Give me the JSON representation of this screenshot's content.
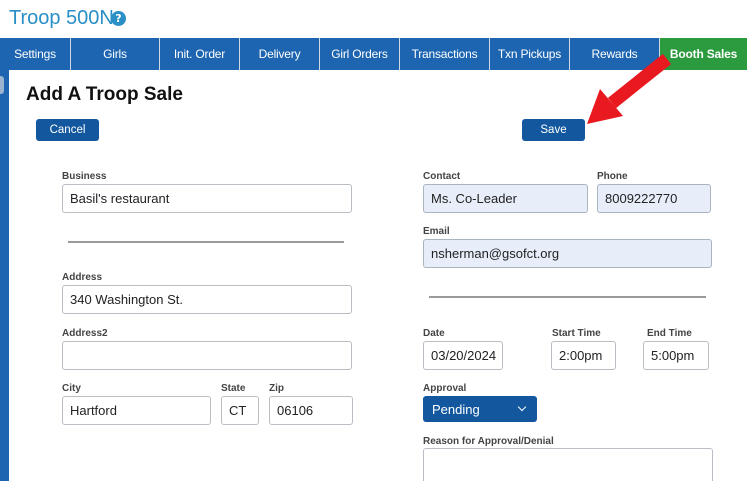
{
  "header": {
    "troop_title": "Troop 500N",
    "help_icon": "help-circle-icon",
    "help_glyph": "?"
  },
  "tabs": [
    {
      "label": "Settings",
      "active": false
    },
    {
      "label": "Girls",
      "active": false
    },
    {
      "label": "Init. Order",
      "active": false
    },
    {
      "label": "Delivery",
      "active": false
    },
    {
      "label": "Girl Orders",
      "active": false
    },
    {
      "label": "Transactions",
      "active": false
    },
    {
      "label": "Txn Pickups",
      "active": false
    },
    {
      "label": "Rewards",
      "active": false
    },
    {
      "label": "Booth Sales",
      "active": true
    }
  ],
  "page": {
    "heading": "Add A Troop Sale"
  },
  "actions": {
    "cancel_label": "Cancel",
    "save_label": "Save"
  },
  "form": {
    "business": {
      "label": "Business",
      "value": "Basil's restaurant"
    },
    "address": {
      "label": "Address",
      "value": "340 Washington St."
    },
    "address2": {
      "label": "Address2",
      "value": ""
    },
    "city": {
      "label": "City",
      "value": "Hartford"
    },
    "state": {
      "label": "State",
      "value": "CT"
    },
    "zip": {
      "label": "Zip",
      "value": "06106"
    },
    "contact": {
      "label": "Contact",
      "value": "Ms. Co-Leader"
    },
    "phone": {
      "label": "Phone",
      "value": "8009222770"
    },
    "email": {
      "label": "Email",
      "value": "nsherman@gsofct.org"
    },
    "date": {
      "label": "Date",
      "value": "03/20/2024"
    },
    "start_time": {
      "label": "Start Time",
      "value": "2:00pm"
    },
    "end_time": {
      "label": "End Time",
      "value": "5:00pm"
    },
    "approval": {
      "label": "Approval",
      "value": "Pending",
      "options": [
        "Pending"
      ]
    },
    "reason": {
      "label": "Reason for Approval/Denial",
      "value": ""
    }
  },
  "colors": {
    "title_blue": "#2a8fc7",
    "tab_bar": "#1d65b0",
    "tab_active": "#2c9a3f",
    "button": "#13589f",
    "readonly_field": "#e7eefa",
    "annotation_arrow": "#e8191f"
  },
  "annotation": {
    "icon": "red-arrow-icon",
    "points_to": "save-button"
  }
}
